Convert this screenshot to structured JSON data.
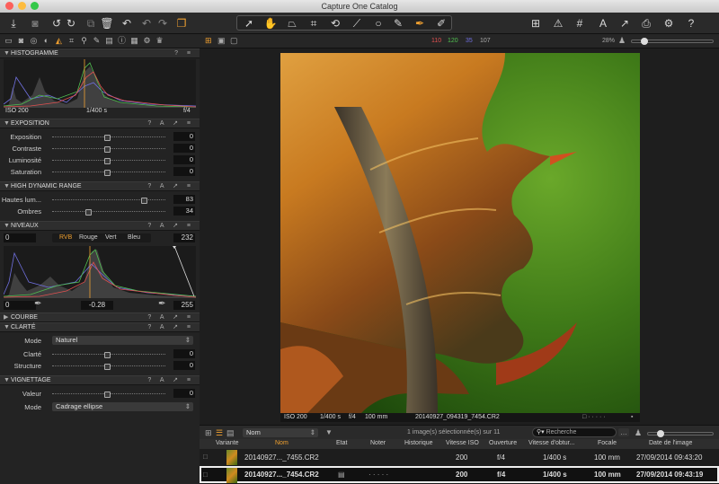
{
  "window": {
    "title": "Capture One Catalog"
  },
  "viewer": {
    "counts": {
      "r": "110",
      "g": "120",
      "b": "35",
      "other": "107"
    },
    "zoom": "28%"
  },
  "histogram": {
    "title": "HISTOGRAMME",
    "iso": "ISO 200",
    "shutter": "1/400 s",
    "aperture": "f/4"
  },
  "exposition": {
    "title": "EXPOSITION",
    "rows": [
      {
        "label": "Exposition",
        "value": "0",
        "level": 0.5
      },
      {
        "label": "Contraste",
        "value": "0",
        "level": 0.5
      },
      {
        "label": "Luminosité",
        "value": "0",
        "level": 0.5
      },
      {
        "label": "Saturation",
        "value": "0",
        "level": 0.5
      }
    ]
  },
  "hdr": {
    "title": "HIGH DYNAMIC RANGE",
    "rows": [
      {
        "label": "Hautes lum...",
        "value": "83",
        "level": 0.83
      },
      {
        "label": "Ombres",
        "value": "34",
        "level": 0.34
      }
    ]
  },
  "niveaux": {
    "title": "NIVEAUX",
    "in_low": "0",
    "in_high": "232",
    "tabs": [
      "RVB",
      "Rouge",
      "Vert",
      "Bleu"
    ],
    "out_low": "0",
    "gamma": "-0.28",
    "out_high": "255"
  },
  "courbe": {
    "title": "COURBE"
  },
  "clarte": {
    "title": "CLARTÉ",
    "mode_label": "Mode",
    "mode_value": "Naturel",
    "rows": [
      {
        "label": "Clarté",
        "value": "0",
        "level": 0.5
      },
      {
        "label": "Structure",
        "value": "0",
        "level": 0.5
      }
    ]
  },
  "vignettage": {
    "title": "VIGNETTAGE",
    "rows": [
      {
        "label": "Valeur",
        "value": "0",
        "level": 0.5
      }
    ],
    "mode_label": "Mode",
    "mode_value": "Cadrage ellipse"
  },
  "photo_info": {
    "iso": "ISO 200",
    "shutter": "1/400 s",
    "aperture": "f/4",
    "focal": "100 mm",
    "filename": "20140927_094319_7454.CR2"
  },
  "browser": {
    "sort": "Nom",
    "status": "1 image(s) sélectionnée(s) sur 11",
    "search_placeholder": "Recherche",
    "columns": [
      "Variante",
      "Nom",
      "Etat",
      "Noter",
      "Historique",
      "Vitesse ISO",
      "Ouverture",
      "Vitesse d'obtur...",
      "Focale",
      "Date de l'image"
    ],
    "rows": [
      {
        "name": "20140927..._7455.CR2",
        "iso": "200",
        "aperture": "f/4",
        "shutter": "1/400 s",
        "focal": "100 mm",
        "date": "27/09/2014 09:43:20",
        "rating": "",
        "selected": false
      },
      {
        "name": "20140927..._7454.CR2",
        "iso": "200",
        "aperture": "f/4",
        "shutter": "1/400 s",
        "focal": "100 mm",
        "date": "27/09/2014 09:43:19",
        "rating": "· · · · ·",
        "selected": true
      }
    ]
  },
  "colors": {
    "accent": "#f0a030",
    "red": "#e05050",
    "green": "#50c050",
    "blue": "#7070e0"
  }
}
